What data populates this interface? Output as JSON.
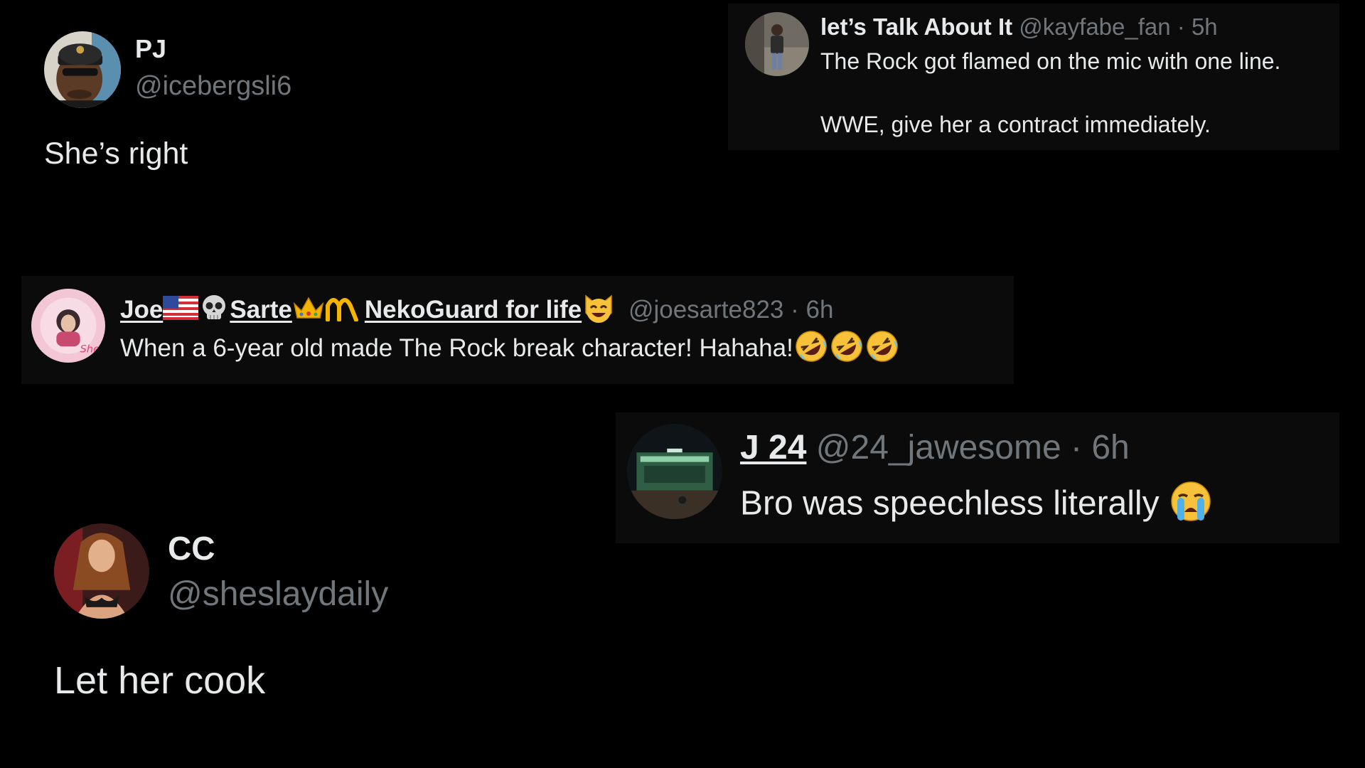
{
  "cards": {
    "pj": {
      "name": "PJ",
      "handle": "@icebergsli6",
      "text": "She’s right",
      "avatar_icon": "user-avatar-cap-sunglasses-icon"
    },
    "kayfabe": {
      "name": "let’s Talk About It",
      "handle": "@kayfabe_fan",
      "time": "· 5h",
      "line1": "The Rock got flamed on the mic with one line.",
      "line2": "WWE, give her a contract immediately.",
      "avatar_icon": "user-avatar-standing-person-icon"
    },
    "joe": {
      "name_part1": "Joe",
      "name_part2": "Sarte",
      "name_part3": "NekoGuard for life",
      "handle": "@joesarte823",
      "time": "· 6h",
      "text": "When a 6-year old made The Rock break character! Hahaha!",
      "emojis": [
        "us-flag-icon",
        "skull-icon",
        "crown-icon",
        "arch-icon",
        "cat-face-icon",
        "rolling-laughing-icon"
      ],
      "avatar_icon": "user-avatar-pink-frame-icon"
    },
    "j24": {
      "name": "J 24",
      "handle": "@24_jawesome",
      "time": "· 6h",
      "text": "Bro was speechless literally",
      "emoji": "loudly-crying-face-icon",
      "avatar_icon": "user-avatar-arena-night-icon"
    },
    "cc": {
      "name": "CC",
      "handle": "@sheslaydaily",
      "text": "Let her cook",
      "avatar_icon": "user-avatar-woman-icon"
    }
  },
  "colors": {
    "background": "#000000",
    "panel": "#0b0b0b",
    "text": "#e7e9ea",
    "muted": "#71767b"
  }
}
